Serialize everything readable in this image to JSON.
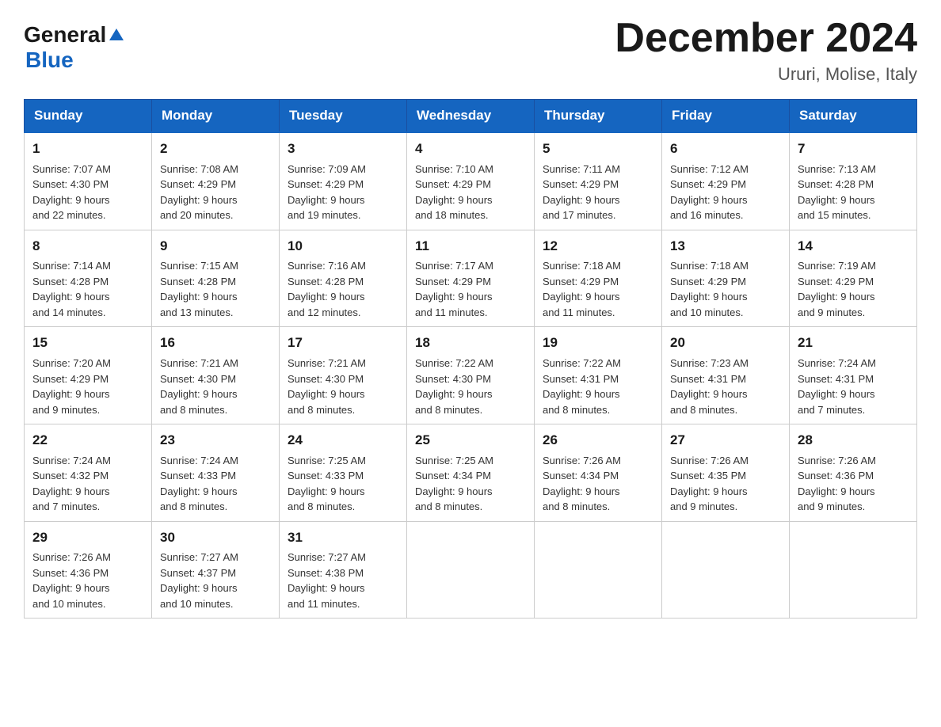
{
  "logo": {
    "general": "General",
    "arrow": "▲",
    "blue": "Blue"
  },
  "title": "December 2024",
  "subtitle": "Ururi, Molise, Italy",
  "days_of_week": [
    "Sunday",
    "Monday",
    "Tuesday",
    "Wednesday",
    "Thursday",
    "Friday",
    "Saturday"
  ],
  "weeks": [
    [
      {
        "day": "1",
        "sunrise": "7:07 AM",
        "sunset": "4:30 PM",
        "daylight": "9 hours and 22 minutes."
      },
      {
        "day": "2",
        "sunrise": "7:08 AM",
        "sunset": "4:29 PM",
        "daylight": "9 hours and 20 minutes."
      },
      {
        "day": "3",
        "sunrise": "7:09 AM",
        "sunset": "4:29 PM",
        "daylight": "9 hours and 19 minutes."
      },
      {
        "day": "4",
        "sunrise": "7:10 AM",
        "sunset": "4:29 PM",
        "daylight": "9 hours and 18 minutes."
      },
      {
        "day": "5",
        "sunrise": "7:11 AM",
        "sunset": "4:29 PM",
        "daylight": "9 hours and 17 minutes."
      },
      {
        "day": "6",
        "sunrise": "7:12 AM",
        "sunset": "4:29 PM",
        "daylight": "9 hours and 16 minutes."
      },
      {
        "day": "7",
        "sunrise": "7:13 AM",
        "sunset": "4:28 PM",
        "daylight": "9 hours and 15 minutes."
      }
    ],
    [
      {
        "day": "8",
        "sunrise": "7:14 AM",
        "sunset": "4:28 PM",
        "daylight": "9 hours and 14 minutes."
      },
      {
        "day": "9",
        "sunrise": "7:15 AM",
        "sunset": "4:28 PM",
        "daylight": "9 hours and 13 minutes."
      },
      {
        "day": "10",
        "sunrise": "7:16 AM",
        "sunset": "4:28 PM",
        "daylight": "9 hours and 12 minutes."
      },
      {
        "day": "11",
        "sunrise": "7:17 AM",
        "sunset": "4:29 PM",
        "daylight": "9 hours and 11 minutes."
      },
      {
        "day": "12",
        "sunrise": "7:18 AM",
        "sunset": "4:29 PM",
        "daylight": "9 hours and 11 minutes."
      },
      {
        "day": "13",
        "sunrise": "7:18 AM",
        "sunset": "4:29 PM",
        "daylight": "9 hours and 10 minutes."
      },
      {
        "day": "14",
        "sunrise": "7:19 AM",
        "sunset": "4:29 PM",
        "daylight": "9 hours and 9 minutes."
      }
    ],
    [
      {
        "day": "15",
        "sunrise": "7:20 AM",
        "sunset": "4:29 PM",
        "daylight": "9 hours and 9 minutes."
      },
      {
        "day": "16",
        "sunrise": "7:21 AM",
        "sunset": "4:30 PM",
        "daylight": "9 hours and 8 minutes."
      },
      {
        "day": "17",
        "sunrise": "7:21 AM",
        "sunset": "4:30 PM",
        "daylight": "9 hours and 8 minutes."
      },
      {
        "day": "18",
        "sunrise": "7:22 AM",
        "sunset": "4:30 PM",
        "daylight": "9 hours and 8 minutes."
      },
      {
        "day": "19",
        "sunrise": "7:22 AM",
        "sunset": "4:31 PM",
        "daylight": "9 hours and 8 minutes."
      },
      {
        "day": "20",
        "sunrise": "7:23 AM",
        "sunset": "4:31 PM",
        "daylight": "9 hours and 8 minutes."
      },
      {
        "day": "21",
        "sunrise": "7:24 AM",
        "sunset": "4:31 PM",
        "daylight": "9 hours and 7 minutes."
      }
    ],
    [
      {
        "day": "22",
        "sunrise": "7:24 AM",
        "sunset": "4:32 PM",
        "daylight": "9 hours and 7 minutes."
      },
      {
        "day": "23",
        "sunrise": "7:24 AM",
        "sunset": "4:33 PM",
        "daylight": "9 hours and 8 minutes."
      },
      {
        "day": "24",
        "sunrise": "7:25 AM",
        "sunset": "4:33 PM",
        "daylight": "9 hours and 8 minutes."
      },
      {
        "day": "25",
        "sunrise": "7:25 AM",
        "sunset": "4:34 PM",
        "daylight": "9 hours and 8 minutes."
      },
      {
        "day": "26",
        "sunrise": "7:26 AM",
        "sunset": "4:34 PM",
        "daylight": "9 hours and 8 minutes."
      },
      {
        "day": "27",
        "sunrise": "7:26 AM",
        "sunset": "4:35 PM",
        "daylight": "9 hours and 9 minutes."
      },
      {
        "day": "28",
        "sunrise": "7:26 AM",
        "sunset": "4:36 PM",
        "daylight": "9 hours and 9 minutes."
      }
    ],
    [
      {
        "day": "29",
        "sunrise": "7:26 AM",
        "sunset": "4:36 PM",
        "daylight": "9 hours and 10 minutes."
      },
      {
        "day": "30",
        "sunrise": "7:27 AM",
        "sunset": "4:37 PM",
        "daylight": "9 hours and 10 minutes."
      },
      {
        "day": "31",
        "sunrise": "7:27 AM",
        "sunset": "4:38 PM",
        "daylight": "9 hours and 11 minutes."
      },
      null,
      null,
      null,
      null
    ]
  ],
  "labels": {
    "sunrise": "Sunrise:",
    "sunset": "Sunset:",
    "daylight": "Daylight:"
  }
}
